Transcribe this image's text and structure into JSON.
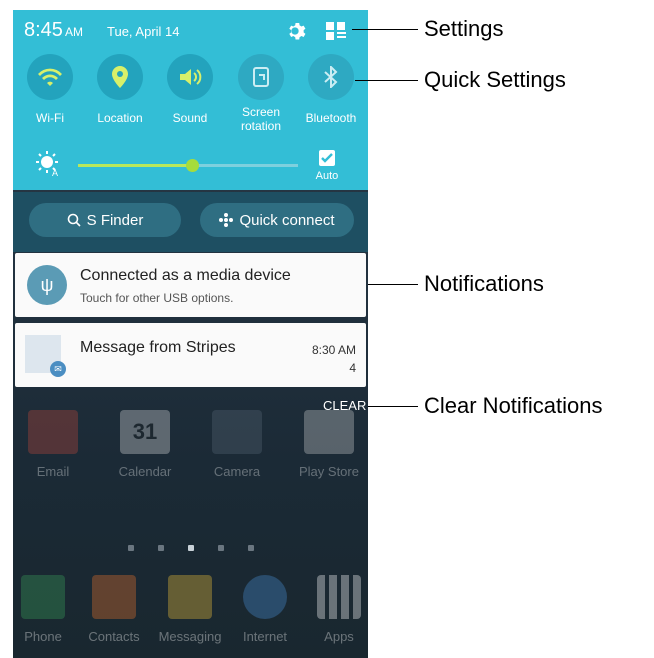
{
  "status_bar": {
    "time": "8:45",
    "ampm": "AM",
    "date": "Tue, April 14"
  },
  "quick_settings": [
    {
      "label": "Wi-Fi",
      "icon": "wifi-icon",
      "state": "on"
    },
    {
      "label": "Location",
      "icon": "location-icon",
      "state": "on"
    },
    {
      "label": "Sound",
      "icon": "sound-icon",
      "state": "on"
    },
    {
      "label": "Screen rotation",
      "icon": "screen-rotation-icon",
      "state": "off"
    },
    {
      "label": "Bluetooth",
      "icon": "bluetooth-icon",
      "state": "off"
    }
  ],
  "brightness": {
    "level": 0.52,
    "auto_label": "Auto",
    "auto_checked": true
  },
  "buttons": {
    "s_finder": "S Finder",
    "quick_connect": "Quick connect"
  },
  "notifications": {
    "usb": {
      "title": "Connected as a media device",
      "subtitle": "Touch for other USB options."
    },
    "message": {
      "title": "Message from Stripes",
      "time": "8:30 AM",
      "count": "4"
    }
  },
  "clear_label": "CLEAR",
  "home_apps_row1": [
    "Email",
    "Calendar",
    "Camera",
    "Play Store"
  ],
  "calendar_day": "31",
  "dock_apps": [
    "Phone",
    "Contacts",
    "Messaging",
    "Internet",
    "Apps"
  ],
  "callouts": {
    "settings": "Settings",
    "quick_settings": "Quick Settings",
    "notifications": "Notifications",
    "clear_notifications": "Clear Notifications"
  },
  "colors": {
    "panel": "#33bed6",
    "accent_green": "#a6dc3c"
  }
}
